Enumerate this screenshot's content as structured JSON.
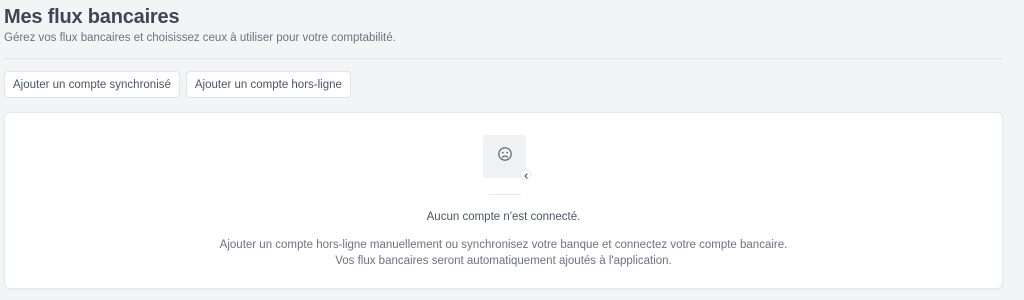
{
  "header": {
    "title": "Mes flux bancaires",
    "subtitle": "Gérez vos flux bancaires et choisissez ceux à utiliser pour votre comptabilité."
  },
  "actions": {
    "add_synced_label": "Ajouter un compte synchronisé",
    "add_offline_label": "Ajouter un compte hors-ligne"
  },
  "empty_state": {
    "icon": "sad-face-icon",
    "title": "Aucun compte n'est connecté.",
    "description_line1": "Ajouter un compte hors-ligne manuellement ou synchronisez votre banque et connectez votre compte bancaire.",
    "description_line2": "Vos flux bancaires seront automatiquement ajoutés à l'application."
  },
  "colors": {
    "background": "#f3f4f6",
    "card": "#ffffff",
    "title": "#3f4555",
    "muted_text": "#6b7280",
    "border": "#e1e3e7"
  }
}
